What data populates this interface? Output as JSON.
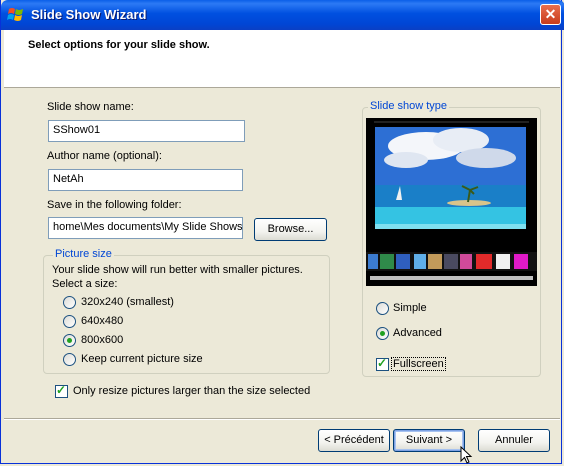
{
  "window": {
    "title": "Slide Show Wizard",
    "close_glyph": "✕"
  },
  "header": {
    "title": "Select options for your slide show."
  },
  "form": {
    "name_label": "Slide show name:",
    "name_value": "SShow01",
    "author_label": "Author name (optional):",
    "author_value": "NetAh",
    "folder_label": "Save in the following folder:",
    "folder_value": "home\\Mes documents\\My Slide Shows",
    "browse_label": "Browse..."
  },
  "picture_size": {
    "title": "Picture size",
    "hint": "Your slide show will run better with smaller pictures.",
    "select_label": "Select a size:",
    "options": [
      "320x240 (smallest)",
      "640x480",
      "800x600",
      "Keep current picture size"
    ],
    "selected_index": 2
  },
  "resize_option": {
    "label": "Only resize pictures larger than the size selected",
    "checked": true
  },
  "slide_type": {
    "title": "Slide show type",
    "options": [
      "Simple",
      "Advanced"
    ],
    "selected_index": 1,
    "fullscreen_label": "Fullscreen",
    "fullscreen_checked": true
  },
  "buttons": {
    "back": "< Précédent",
    "next": "Suivant >",
    "cancel": "Annuler"
  },
  "colors": {
    "titlebar": "#0050e0",
    "accent_group_title": "#0046d5",
    "radio_dot": "#21a121"
  }
}
